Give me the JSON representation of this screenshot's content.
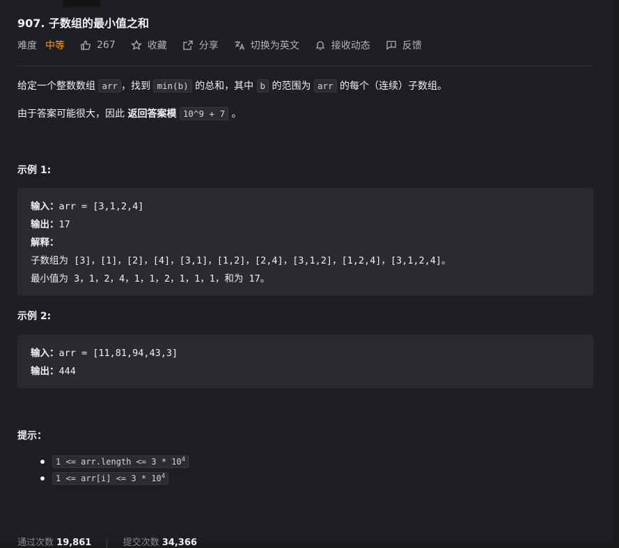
{
  "problem": {
    "title": "907. 子数组的最小值之和",
    "difficulty_label": "难度",
    "difficulty": "中等",
    "likes": "267",
    "collect": "收藏",
    "share": "分享",
    "translate": "切换为英文",
    "notify": "接收动态",
    "feedback": "反馈"
  },
  "description": {
    "p1_a": "给定一个整数数组",
    "p1_code1": "arr",
    "p1_b": "，找到",
    "p1_code2": "min(b)",
    "p1_c": "的总和，其中",
    "p1_code3": "b",
    "p1_d": "的范围为",
    "p1_code4": "arr",
    "p1_e": "的每个（连续）子数组。",
    "p2_a": "由于答案可能很大，因此",
    "p2_bold": "返回答案模",
    "p2_code": "10^9 + 7",
    "p2_end": "。"
  },
  "examples": [
    {
      "heading": "示例 1:",
      "input_label": "输入：",
      "input": "arr = [3,1,2,4]",
      "output_label": "输出：",
      "output": "17",
      "explain_label": "解释：",
      "explain_line1": "子数组为 [3]，[1]，[2]，[4]，[3,1]，[1,2]，[2,4]，[3,1,2]，[1,2,4]，[3,1,2,4]。",
      "explain_line2": "最小值为 3，1，2，4，1，1，2，1，1，1，和为 17。"
    },
    {
      "heading": "示例 2:",
      "input_label": "输入：",
      "input": "arr = [11,81,94,43,3]",
      "output_label": "输出：",
      "output": "444"
    }
  ],
  "hints": {
    "heading": "提示：",
    "items": [
      {
        "text": "1 <= arr.length <= 3 * 10",
        "sup": "4"
      },
      {
        "text": "1 <= arr[i] <= 3 * 10",
        "sup": "4"
      }
    ]
  },
  "footer": {
    "accepted_label": "通过次数",
    "accepted": "19,861",
    "submitted_label": "提交次数",
    "submitted": "34,366"
  }
}
